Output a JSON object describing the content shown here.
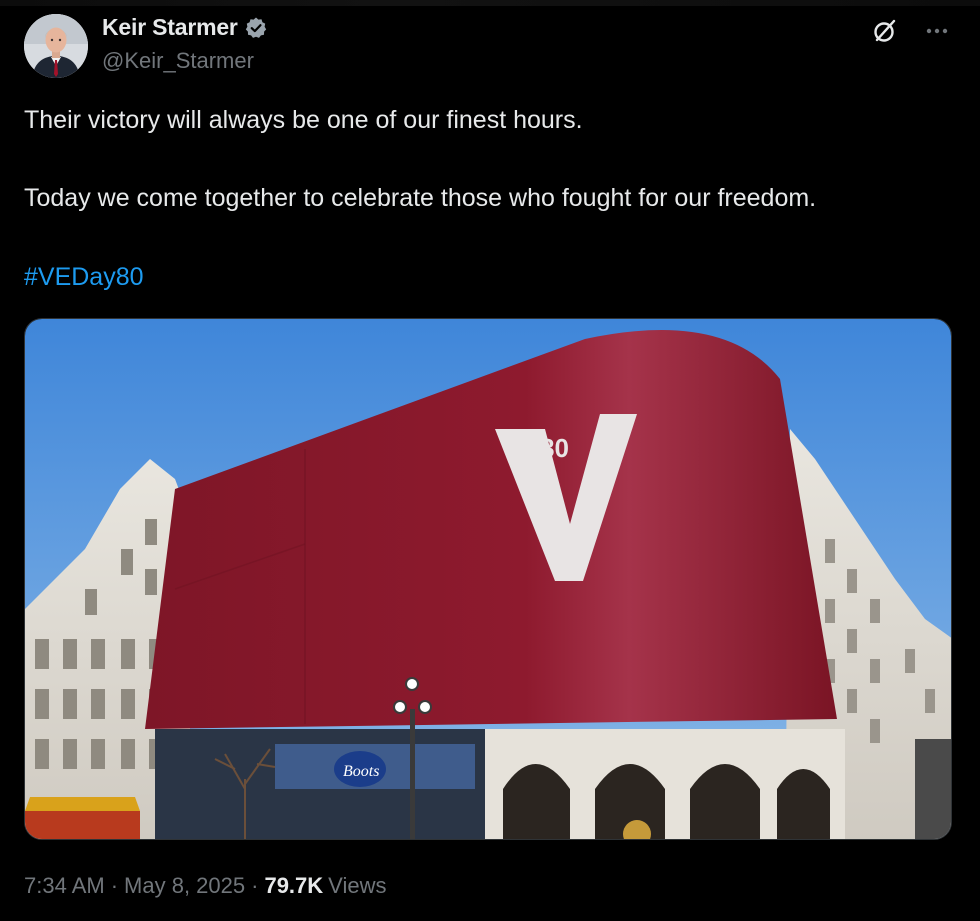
{
  "author": {
    "display_name": "Keir Starmer",
    "handle": "@Keir_Starmer",
    "verified": true
  },
  "tweet": {
    "line1": "Their victory will always be one of our finest hours.",
    "line2": "Today we come together to celebrate those who fought for our freedom.",
    "hashtag": "#VEDay80"
  },
  "media": {
    "logo_number": "80",
    "logo_letter": "V",
    "boots_sign": "Boots"
  },
  "meta": {
    "time": "7:34 AM",
    "date": "May 8, 2025",
    "views_count": "79.7K",
    "views_label": "Views",
    "separator": "·"
  },
  "icons": {
    "verified": "verified-badge-icon",
    "grok": "grok-icon",
    "more": "more-icon"
  },
  "colors": {
    "background": "#000000",
    "text": "#e7e9ea",
    "secondary": "#71767b",
    "link": "#1d9bf0",
    "billboard": "#8e1a2e"
  }
}
